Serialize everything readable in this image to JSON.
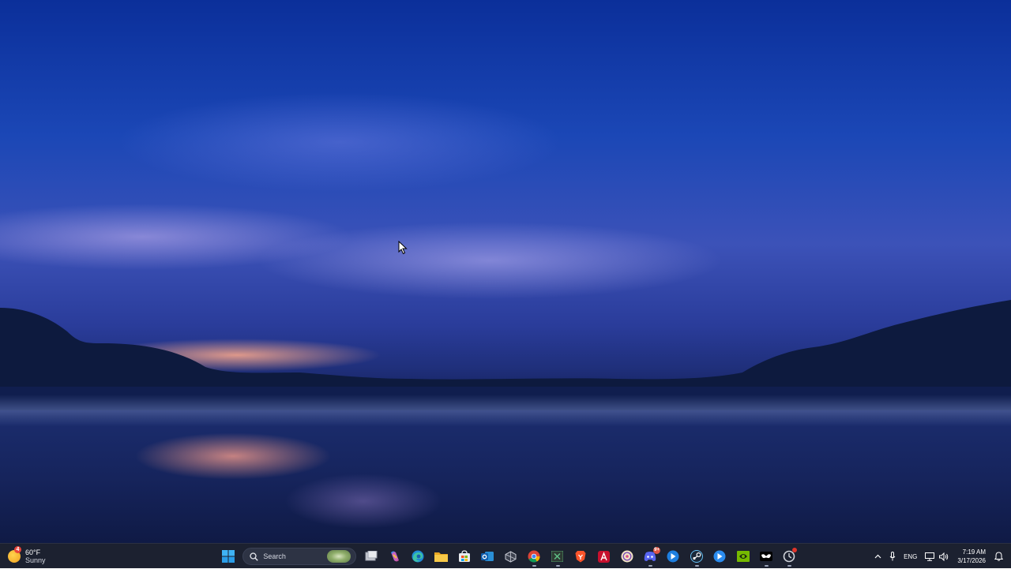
{
  "desktop": {
    "wallpaper": "misty lake at dusk"
  },
  "taskbar": {
    "weather": {
      "temperature": "60°F",
      "condition": "Sunny",
      "badge": "4",
      "icon": "sun-icon"
    },
    "search": {
      "label": "Search"
    },
    "apps": [
      {
        "name": "start-button",
        "icon": "windows-logo-icon"
      },
      {
        "name": "task-view-button",
        "icon": "task-view-icon"
      },
      {
        "name": "copilot-button",
        "icon": "copilot-icon"
      },
      {
        "name": "edge-button",
        "icon": "edge-icon"
      },
      {
        "name": "file-explorer-button",
        "icon": "folder-icon"
      },
      {
        "name": "microsoft-store-button",
        "icon": "store-icon"
      },
      {
        "name": "outlook-button",
        "icon": "outlook-icon"
      },
      {
        "name": "app-cube-button",
        "icon": "cube-icon"
      },
      {
        "name": "chrome-button",
        "icon": "chrome-icon"
      },
      {
        "name": "excel-button",
        "icon": "excel-icon"
      },
      {
        "name": "brave-button",
        "icon": "brave-icon"
      },
      {
        "name": "acrobat-button",
        "icon": "acrobat-icon"
      },
      {
        "name": "app-circle-button",
        "icon": "circle-app-icon"
      },
      {
        "name": "discord-button",
        "icon": "discord-icon",
        "badge": "9+"
      },
      {
        "name": "app-blue-button",
        "icon": "blue-app-icon"
      },
      {
        "name": "steam-button",
        "icon": "steam-icon"
      },
      {
        "name": "app-blue2-button",
        "icon": "blue-app2-icon"
      },
      {
        "name": "nvidia-button",
        "icon": "nvidia-icon"
      },
      {
        "name": "app-mask-button",
        "icon": "mask-icon"
      },
      {
        "name": "app-ring-button",
        "icon": "ring-icon"
      }
    ],
    "tray": {
      "language": "ENG",
      "time": "7:19 AM",
      "date": "3/17/2026"
    }
  }
}
